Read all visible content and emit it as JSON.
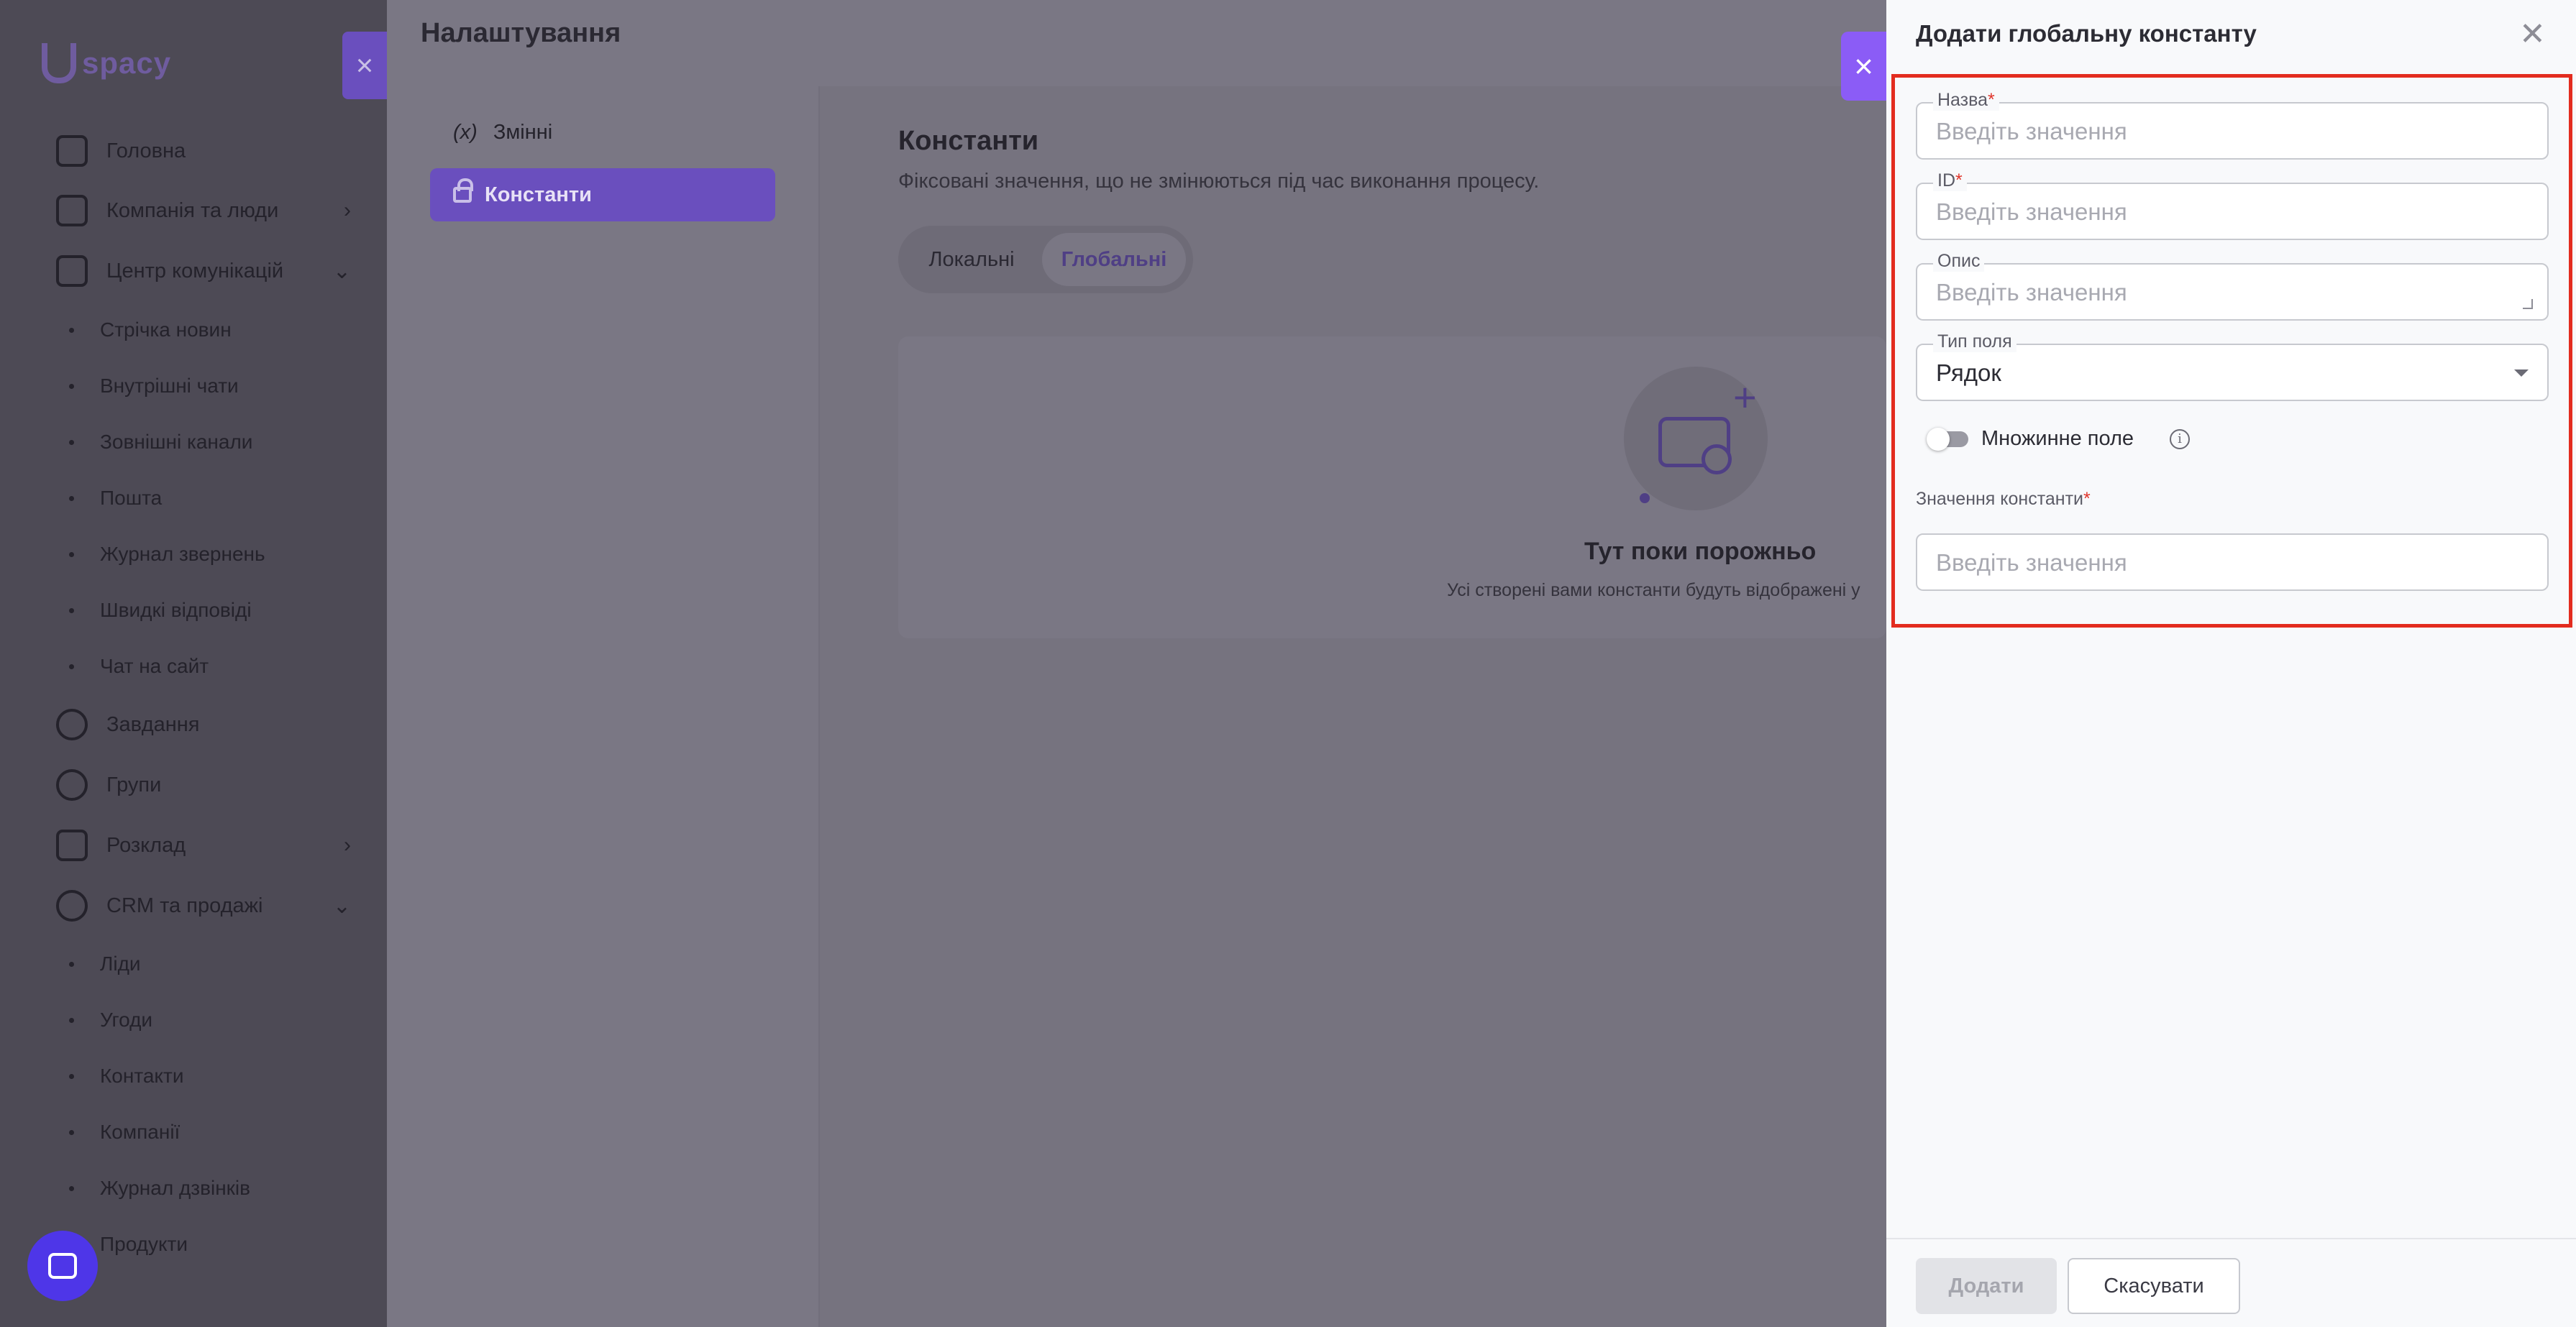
{
  "app": {
    "logo_text": "spacy"
  },
  "sidebar": {
    "items": [
      {
        "label": "Головна",
        "icon": "home-icon"
      },
      {
        "label": "Компанія та люди",
        "icon": "building-icon",
        "chevron": "›"
      },
      {
        "label": "Центр комунікацій",
        "icon": "chat-icon",
        "chevron": "⌄"
      },
      {
        "label": "Завдання",
        "icon": "check-circle-icon"
      },
      {
        "label": "Групи",
        "icon": "users-icon"
      },
      {
        "label": "Розклад",
        "icon": "calendar-icon",
        "chevron": "›"
      },
      {
        "label": "CRM та продажі",
        "icon": "database-icon",
        "chevron": "⌄"
      }
    ],
    "comm_sub": [
      "Стрічка новин",
      "Внутрішні чати",
      "Зовнішні канали",
      "Пошта",
      "Журнал звернень",
      "Швидкі відповіді",
      "Чат на сайт"
    ],
    "crm_sub": [
      "Ліди",
      "Угоди",
      "Контакти",
      "Компанії",
      "Журнал дзвінків",
      "Продукти"
    ]
  },
  "settings": {
    "title": "Налаштування",
    "close_icon": "×",
    "menu": {
      "variables": "Змінні",
      "variables_icon": "(x)",
      "constants": "Константи"
    },
    "constants_title": "Константи",
    "constants_subtitle": "Фіксовані значення, що не змінюються під час виконання процесу.",
    "tabs": {
      "local": "Локальні",
      "global": "Глобальні"
    },
    "empty": {
      "title": "Тут поки порожньо",
      "subtitle": "Усі створені вами константи будуть відображені у",
      "plus": "+"
    }
  },
  "drawer": {
    "close_icon": "×",
    "title": "Додати глобальну константу",
    "x_icon": "✕",
    "fields": {
      "name": {
        "label": "Назва",
        "required": "*",
        "placeholder": "Введіть значення"
      },
      "id": {
        "label": "ID",
        "required": "*",
        "placeholder": "Введіть значення"
      },
      "description": {
        "label": "Опис",
        "placeholder": "Введіть значення"
      },
      "type": {
        "label": "Тип поля",
        "value": "Рядок"
      },
      "multiple": {
        "label": "Множинне поле",
        "info": "i"
      },
      "value": {
        "label": "Значення константи",
        "required": "*",
        "placeholder": "Введіть значення"
      }
    },
    "buttons": {
      "add": "Додати",
      "cancel": "Скасувати"
    }
  },
  "colors": {
    "accent": "#8b5cf6",
    "highlight": "#e32c1f",
    "required": "#e0352b"
  }
}
